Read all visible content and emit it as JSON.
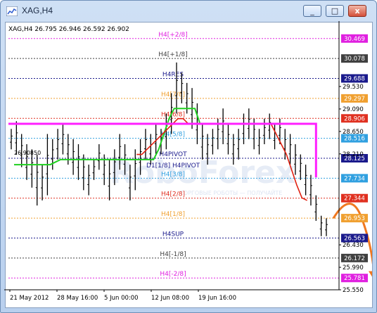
{
  "window": {
    "title": "XAG,H4",
    "minimize_glyph": "_",
    "maximize_glyph": "□",
    "close_glyph": "x"
  },
  "chart": {
    "header": "XAG,H4  26.795 26.946 26.592 26.902",
    "watermark": "RoboForex",
    "watermark_sub": "ТОРГОВЫЕ РОБОТЫ — ПОЛУЧАЙТЕ",
    "inline_label_d1": "D1[1/8] H4PIVOT",
    "inline_label_left": "26.90850",
    "levels": [
      {
        "name": "H4[+2/8]",
        "price": "30.469",
        "color": "#e020e0",
        "box_bg": "#e020e0",
        "box_fg": "#ffffff"
      },
      {
        "name": "H4[+1/8]",
        "price": "30.078",
        "color": "#404040",
        "box_bg": "#404040",
        "box_fg": "#ffffff"
      },
      {
        "name": "H4RES",
        "price": "29.688",
        "color": "#1a1a8c",
        "box_bg": "#1a1a8c",
        "box_fg": "#ffffff"
      },
      {
        "name": "H4[7/8]",
        "price": "29.297",
        "color": "#f0a030",
        "box_bg": "#f0a030",
        "box_fg": "#ffffff"
      },
      {
        "name": "H4[6/8]",
        "price": "28.906",
        "color": "#e03020",
        "box_bg": "#e03020",
        "box_fg": "#ffffff"
      },
      {
        "name": "H4[5/8]",
        "price": "28.516",
        "color": "#30a0e0",
        "box_bg": "#30a0e0",
        "box_fg": "#ffffff"
      },
      {
        "name": "H4PIVOT",
        "price": "28.125",
        "color": "#1a1a8c",
        "box_bg": "#1a1a8c",
        "box_fg": "#ffffff"
      },
      {
        "name": "H4[3/8]",
        "price": "27.734",
        "color": "#30a0e0",
        "box_bg": "#30a0e0",
        "box_fg": "#ffffff"
      },
      {
        "name": "H4[2/8]",
        "price": "27.344",
        "color": "#e03020",
        "box_bg": "#e03020",
        "box_fg": "#ffffff"
      },
      {
        "name": "H4[1/8]",
        "price": "26.953",
        "color": "#f0a030",
        "box_bg": "#f0a030",
        "box_fg": "#ffffff"
      },
      {
        "name": "H4SUP",
        "price": "26.563",
        "color": "#1a1a8c",
        "box_bg": "#1a1a8c",
        "box_fg": "#ffffff"
      },
      {
        "name": "H4[-1/8]",
        "price": "26.172",
        "color": "#404040",
        "box_bg": "#404040",
        "box_fg": "#ffffff"
      },
      {
        "name": "H4[-2/8]",
        "price": "25.781",
        "color": "#e020e0",
        "box_bg": "#e020e0",
        "box_fg": "#ffffff"
      }
    ],
    "right_ticks": [
      "29.530",
      "29.090",
      "28.650",
      "28.210",
      "26.430",
      "25.990",
      "25.550"
    ],
    "x_ticks": [
      "21 May 2012",
      "28 May 16:00",
      "5 Jun 00:00",
      "12 Jun 08:00",
      "19 Jun 16:00"
    ],
    "colors": {
      "bars": "#000000",
      "green_line": "#20d020",
      "red_line": "#e02010",
      "magenta_line": "#ff20ff",
      "forecast_arrow": "#f07820"
    }
  },
  "chart_data": {
    "type": "ohlc",
    "symbol": "XAG",
    "timeframe": "H4",
    "ohlc_header": {
      "open": 26.795,
      "high": 26.946,
      "low": 26.592,
      "close": 26.902
    },
    "ylim": [
      25.55,
      30.7
    ],
    "bars": [
      {
        "x": 0,
        "h": 28.7,
        "l": 28.3
      },
      {
        "x": 1,
        "h": 28.85,
        "l": 28.2
      },
      {
        "x": 2,
        "h": 28.6,
        "l": 27.95
      },
      {
        "x": 3,
        "h": 28.4,
        "l": 27.7
      },
      {
        "x": 4,
        "h": 28.3,
        "l": 27.55
      },
      {
        "x": 5,
        "h": 28.2,
        "l": 27.2
      },
      {
        "x": 6,
        "h": 28.0,
        "l": 27.3
      },
      {
        "x": 7,
        "h": 28.6,
        "l": 27.4
      },
      {
        "x": 8,
        "h": 28.5,
        "l": 27.9
      },
      {
        "x": 9,
        "h": 28.7,
        "l": 28.1
      },
      {
        "x": 10,
        "h": 28.8,
        "l": 28.2
      },
      {
        "x": 11,
        "h": 28.6,
        "l": 28.0
      },
      {
        "x": 12,
        "h": 28.5,
        "l": 27.8
      },
      {
        "x": 13,
        "h": 28.4,
        "l": 27.7
      },
      {
        "x": 14,
        "h": 28.2,
        "l": 27.5
      },
      {
        "x": 15,
        "h": 28.0,
        "l": 27.4
      },
      {
        "x": 16,
        "h": 28.1,
        "l": 27.7
      },
      {
        "x": 17,
        "h": 28.4,
        "l": 27.9
      },
      {
        "x": 18,
        "h": 28.2,
        "l": 27.6
      },
      {
        "x": 19,
        "h": 28.1,
        "l": 27.3
      },
      {
        "x": 20,
        "h": 28.3,
        "l": 27.6
      },
      {
        "x": 21,
        "h": 28.6,
        "l": 27.9
      },
      {
        "x": 22,
        "h": 28.4,
        "l": 27.8
      },
      {
        "x": 23,
        "h": 28.0,
        "l": 27.3
      },
      {
        "x": 24,
        "h": 28.3,
        "l": 27.5
      },
      {
        "x": 25,
        "h": 28.5,
        "l": 27.8
      },
      {
        "x": 26,
        "h": 28.7,
        "l": 28.1
      },
      {
        "x": 27,
        "h": 28.6,
        "l": 28.0
      },
      {
        "x": 28,
        "h": 28.8,
        "l": 28.2
      },
      {
        "x": 29,
        "h": 28.7,
        "l": 28.2
      },
      {
        "x": 30,
        "h": 29.0,
        "l": 28.3
      },
      {
        "x": 31,
        "h": 29.4,
        "l": 28.6
      },
      {
        "x": 32,
        "h": 30.0,
        "l": 29.0
      },
      {
        "x": 33,
        "h": 29.8,
        "l": 29.2
      },
      {
        "x": 34,
        "h": 29.6,
        "l": 29.0
      },
      {
        "x": 35,
        "h": 29.5,
        "l": 28.7
      },
      {
        "x": 36,
        "h": 29.2,
        "l": 28.4
      },
      {
        "x": 37,
        "h": 28.8,
        "l": 28.1
      },
      {
        "x": 38,
        "h": 28.6,
        "l": 28.0
      },
      {
        "x": 39,
        "h": 28.7,
        "l": 28.2
      },
      {
        "x": 40,
        "h": 28.9,
        "l": 28.3
      },
      {
        "x": 41,
        "h": 29.1,
        "l": 28.4
      },
      {
        "x": 42,
        "h": 28.8,
        "l": 28.2
      },
      {
        "x": 43,
        "h": 28.6,
        "l": 28.0
      },
      {
        "x": 44,
        "h": 28.7,
        "l": 28.1
      },
      {
        "x": 45,
        "h": 29.0,
        "l": 28.4
      },
      {
        "x": 46,
        "h": 29.1,
        "l": 28.5
      },
      {
        "x": 47,
        "h": 28.9,
        "l": 28.3
      },
      {
        "x": 48,
        "h": 28.7,
        "l": 28.2
      },
      {
        "x": 49,
        "h": 28.9,
        "l": 28.4
      },
      {
        "x": 50,
        "h": 29.0,
        "l": 28.5
      },
      {
        "x": 51,
        "h": 28.8,
        "l": 28.3
      },
      {
        "x": 52,
        "h": 28.9,
        "l": 28.4
      },
      {
        "x": 53,
        "h": 28.7,
        "l": 28.1
      },
      {
        "x": 54,
        "h": 28.6,
        "l": 28.0
      },
      {
        "x": 55,
        "h": 28.4,
        "l": 27.8
      },
      {
        "x": 56,
        "h": 28.2,
        "l": 27.7
      },
      {
        "x": 57,
        "h": 28.0,
        "l": 27.4
      },
      {
        "x": 58,
        "h": 27.8,
        "l": 27.2
      },
      {
        "x": 59,
        "h": 27.4,
        "l": 26.9
      },
      {
        "x": 60,
        "h": 27.0,
        "l": 26.6
      },
      {
        "x": 61,
        "h": 26.95,
        "l": 26.6
      }
    ],
    "green_line": [
      28.0,
      28.0,
      28.0,
      28.0,
      28.0,
      28.0,
      28.0,
      28.0,
      28.05,
      28.1,
      28.1,
      28.1,
      28.1,
      28.1,
      28.1,
      28.1,
      28.1,
      28.1,
      28.1,
      28.1,
      28.1,
      28.1,
      28.1,
      28.1,
      28.1,
      28.1,
      28.1,
      28.1,
      28.3,
      28.6,
      28.9,
      29.1,
      29.1,
      29.1,
      29.1,
      29.1,
      28.8,
      28.8,
      28.8,
      28.8,
      28.8,
      28.8,
      28.8,
      28.8,
      28.8,
      28.8,
      28.8,
      28.8,
      28.8,
      28.8,
      28.8,
      28.8
    ],
    "red_line_start_index": 24,
    "red_line": [
      28.2,
      28.2,
      28.3,
      28.4,
      28.5,
      28.6,
      28.7,
      28.8,
      28.9,
      28.9,
      28.8,
      28.8,
      28.8,
      28.8,
      28.8,
      28.8,
      28.8,
      28.8,
      28.8,
      28.8,
      28.8,
      28.8,
      28.8,
      28.8,
      28.8,
      28.8,
      28.8,
      28.6,
      28.4,
      28.2,
      27.9,
      27.6,
      27.35,
      27.3
    ],
    "magenta_line": {
      "level": 28.8,
      "drop_to": 27.75
    },
    "forecast": {
      "from_price": 26.95,
      "peak_price": 27.1,
      "to_price": 25.75
    }
  }
}
